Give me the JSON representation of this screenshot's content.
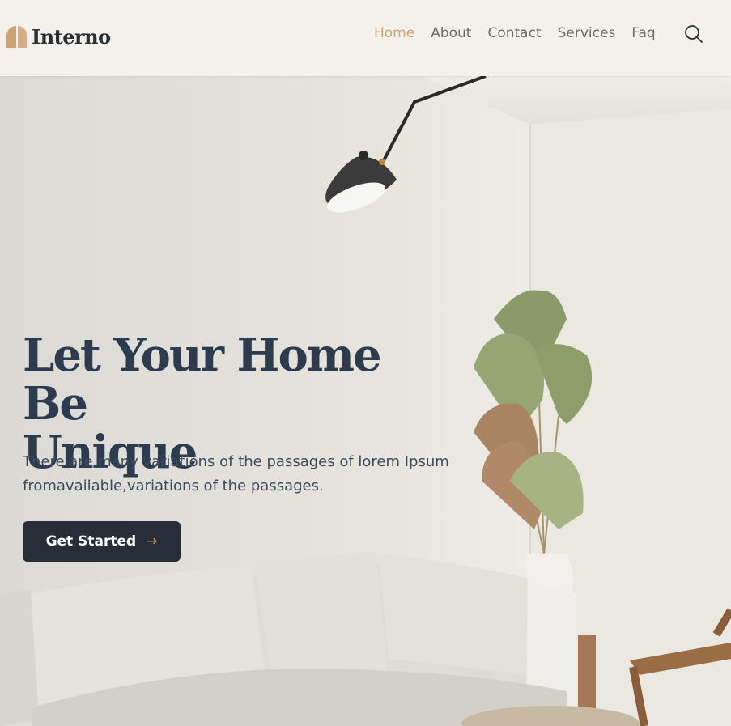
{
  "brand": {
    "name": "Interno",
    "accent": "#cda274",
    "dark": "#292f36"
  },
  "nav": {
    "items": [
      {
        "label": "Home",
        "active": true
      },
      {
        "label": "About",
        "active": false
      },
      {
        "label": "Contact",
        "active": false
      },
      {
        "label": "Services",
        "active": false
      },
      {
        "label": "Faq",
        "active": false
      }
    ],
    "search_icon": "search-icon"
  },
  "hero": {
    "title_line1": "Let Your Home Be",
    "title_line2": "Unique",
    "description": "There are many variations of the passages of lorem Ipsum fromavailable,variations of the passages.",
    "cta_label": "Get Started",
    "cta_arrow": "→",
    "image": "living-room-photo"
  }
}
